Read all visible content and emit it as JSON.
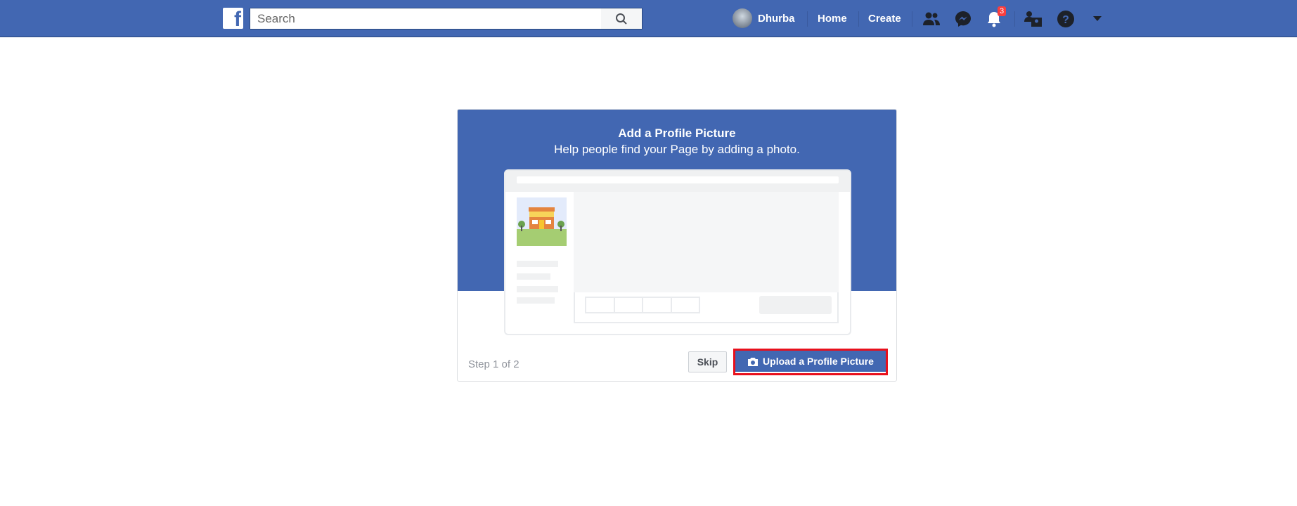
{
  "header": {
    "logo": "f",
    "search": {
      "placeholder": "Search",
      "value": ""
    },
    "user_name": "Dhurba",
    "nav": {
      "home": "Home",
      "create": "Create"
    },
    "notification_count": "3",
    "icons": [
      "friends-icon",
      "messenger-icon",
      "notifications-icon",
      "page-admin-icon",
      "help-icon",
      "caret-down-icon"
    ]
  },
  "card": {
    "title": "Add a Profile Picture",
    "subtitle": "Help people find your Page by adding a photo.",
    "step": "Step 1 of 2",
    "skip_label": "Skip",
    "upload_label": "Upload a Profile Picture"
  },
  "colors": {
    "brand": "#4267b2",
    "highlight": "#e8101c",
    "badge": "#fa3e3e"
  }
}
